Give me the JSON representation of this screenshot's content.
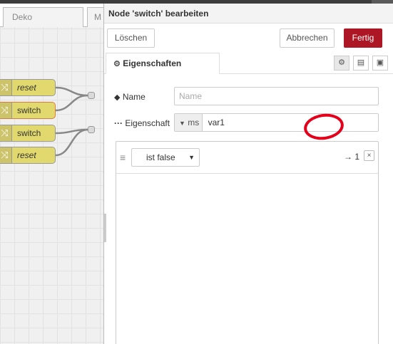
{
  "workspace": {
    "tabs": [
      {
        "label": "Deko"
      },
      {
        "label": "M"
      }
    ],
    "nodes": [
      {
        "label": "reset",
        "italic": true
      },
      {
        "label": "switch",
        "italic": false
      },
      {
        "label": "switch",
        "italic": false
      },
      {
        "label": "reset",
        "italic": true
      }
    ]
  },
  "tray": {
    "title": "Node 'switch' bearbeiten",
    "delete_label": "Löschen",
    "cancel_label": "Abbrechen",
    "done_label": "Fertig",
    "tab_label": "Eigenschaften",
    "tab_icons": [
      "gear-icon",
      "description-icon",
      "appearance-icon"
    ]
  },
  "form": {
    "name_label": "Name",
    "name_placeholder": "Name",
    "name_value": "",
    "property_label": "Eigenschaft",
    "property_prefix": "ms",
    "property_value": "var1",
    "rule_operator": "ist false",
    "rule_output_arrow": "→",
    "rule_output_num": "1",
    "rule_delete": "×"
  },
  "colors": {
    "accent": "#ad1625",
    "node_fill": "#e2d96e",
    "annotation_circle": "#e4001a"
  }
}
